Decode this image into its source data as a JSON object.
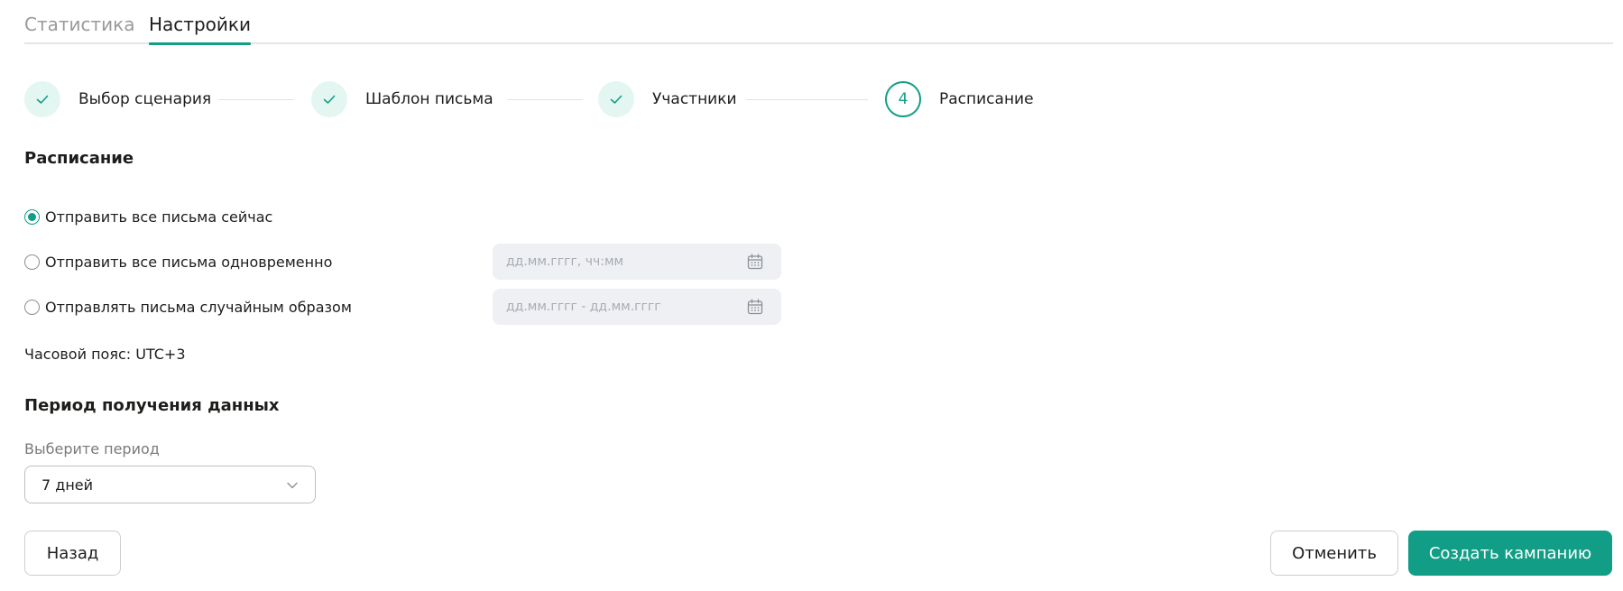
{
  "tabs": [
    {
      "label": "Статистика",
      "active": false
    },
    {
      "label": "Настройки",
      "active": true
    }
  ],
  "stepper": {
    "steps": [
      {
        "label": "Выбор сценария",
        "status": "done",
        "icon": "check-icon"
      },
      {
        "label": "Шаблон письма",
        "status": "done",
        "icon": "check-icon"
      },
      {
        "label": "Участники",
        "status": "done",
        "icon": "check-icon"
      },
      {
        "label": "Расписание",
        "status": "current",
        "number": "4"
      }
    ]
  },
  "schedule": {
    "title": "Расписание",
    "options": [
      {
        "label": "Отправить все письма сейчас",
        "checked": true
      },
      {
        "label": "Отправить все письма одновременно",
        "checked": false,
        "input_placeholder": "дд.мм.гггг, чч:мм"
      },
      {
        "label": "Отправлять письма случайным образом",
        "checked": false,
        "input_placeholder": "дд.мм.гггг - дд.мм.гггг"
      }
    ],
    "timezone": "Часовой пояс: UTC+3"
  },
  "period": {
    "title": "Период получения данных",
    "field_label": "Выберите период",
    "selected_value": "7 дней"
  },
  "footer": {
    "back_label": "Назад",
    "cancel_label": "Отменить",
    "create_label": "Создать кампанию"
  },
  "colors": {
    "accent": "#129e86",
    "step_done_bg": "#e3f6f2",
    "input_bg": "#eef0f3"
  }
}
